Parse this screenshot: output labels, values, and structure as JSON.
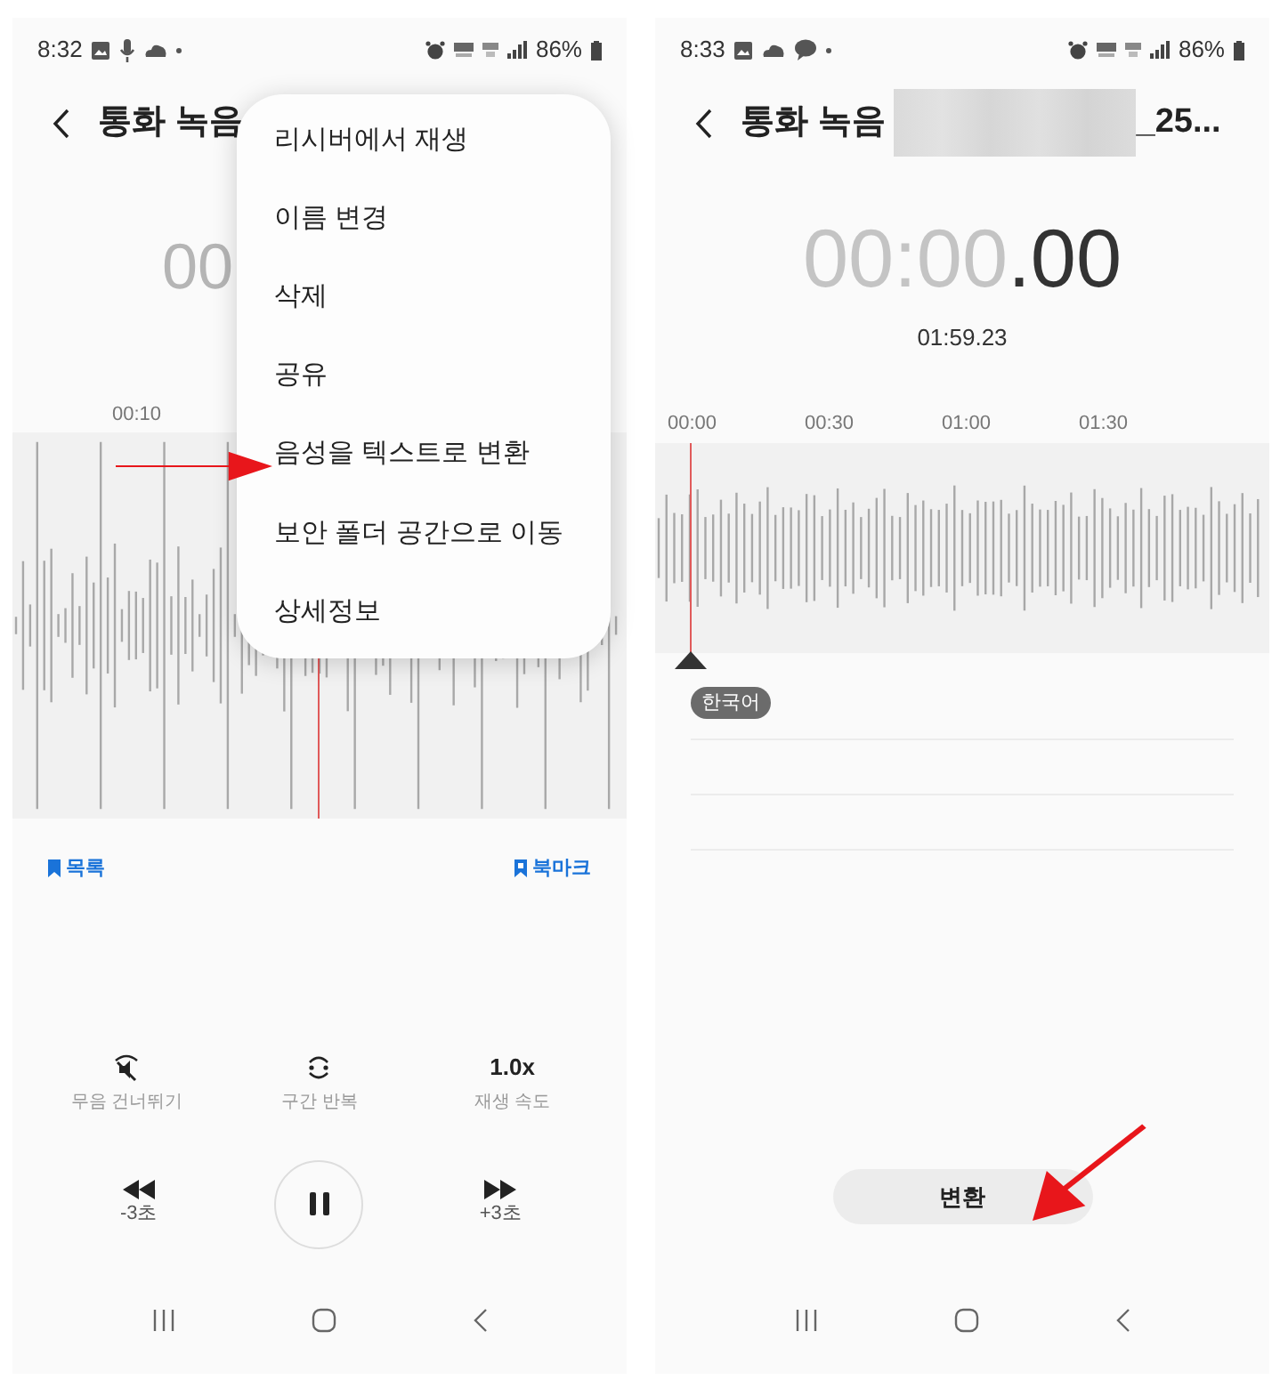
{
  "phones": [
    {
      "status_bar": {
        "time": "8:32",
        "battery": "86%"
      },
      "title": "통화 녹음",
      "timer": {
        "elapsed": "00"
      },
      "ticks": [
        "00:10"
      ],
      "menu": {
        "items": [
          "리시버에서 재생",
          "이름 변경",
          "삭제",
          "공유",
          "음성을 텍스트로 변환",
          "보안 폴더 공간으로 이동",
          "상세정보"
        ]
      },
      "bookmarks": {
        "list": "목록",
        "add": "북마크"
      },
      "options": [
        {
          "kind": "skip-silence",
          "label": "무음 건너뛰기"
        },
        {
          "kind": "repeat",
          "label": "구간 반복"
        },
        {
          "kind": "speed",
          "value": "1.0x",
          "label": "재생 속도"
        }
      ],
      "transport": {
        "back": "-3초",
        "forward": "+3초",
        "playing": true
      }
    },
    {
      "status_bar": {
        "time": "8:33",
        "battery": "86%"
      },
      "title": "통화 녹음",
      "title_suffix": "_25...",
      "timer": {
        "elapsed": "00:00",
        "fraction": ".00",
        "total": "01:59.23"
      },
      "ticks": [
        "00:00",
        "00:30",
        "01:00",
        "01:30"
      ],
      "language": "한국어",
      "convert_button": "변환"
    }
  ]
}
